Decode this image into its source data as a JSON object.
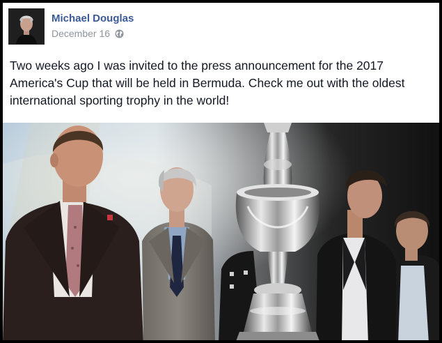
{
  "post": {
    "author": "Michael Douglas",
    "date": "December 16",
    "privacy_icon": "globe-icon",
    "text": "Two weeks ago I was invited to the press announcement for the 2017 America's Cup that will be held in Bermuda. Check me out with the oldest international sporting trophy in the world!"
  },
  "colors": {
    "author_link": "#3b5998",
    "date_text": "#90949c",
    "body_text": "#141823",
    "frame_border": "#000000"
  }
}
